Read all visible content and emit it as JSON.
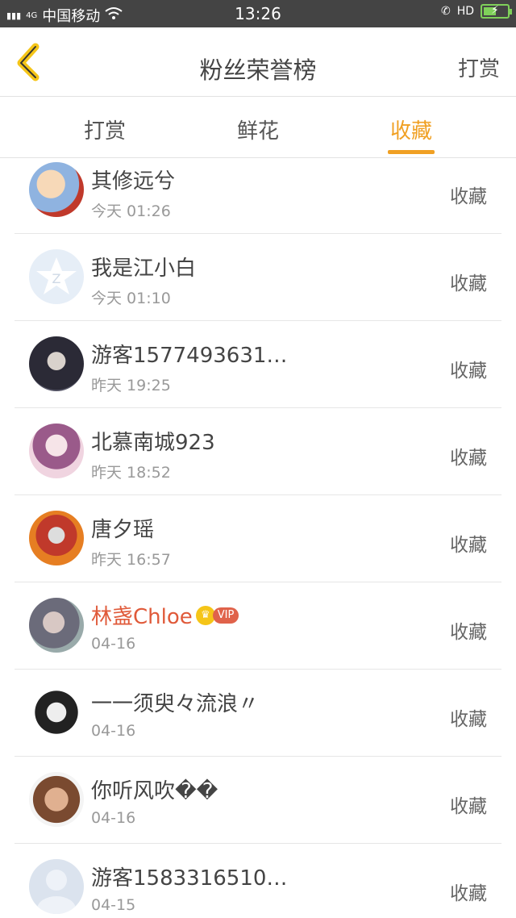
{
  "status_bar": {
    "network_label": "4G",
    "carrier": "中国移动",
    "time": "13:26",
    "hd_label": "HD",
    "battery_level": 0.55
  },
  "navbar": {
    "back_icon": "chevron-left-icon",
    "title": "粉丝荣誉榜",
    "right_label": "打赏"
  },
  "tabs": [
    {
      "label": "打赏",
      "active": false
    },
    {
      "label": "鲜花",
      "active": false
    },
    {
      "label": "收藏",
      "active": true
    }
  ],
  "accent_color": "#f0a023",
  "fans": [
    {
      "name": "其修远兮",
      "time": "今天 01:26",
      "action": "收藏",
      "vip": false
    },
    {
      "name": "我是江小白",
      "time": "今天 01:10",
      "action": "收藏",
      "vip": false
    },
    {
      "name": "游客1577493631…",
      "time": "昨天 19:25",
      "action": "收藏",
      "vip": false
    },
    {
      "name": "北慕南城923",
      "time": "昨天 18:52",
      "action": "收藏",
      "vip": false
    },
    {
      "name": "唐夕瑶",
      "time": "昨天 16:57",
      "action": "收藏",
      "vip": false
    },
    {
      "name": "林盏Chloe",
      "time": "04-16",
      "action": "收藏",
      "vip": true,
      "vip_label": "VIP"
    },
    {
      "name": "一一须臾々流浪〃",
      "time": "04-16",
      "action": "收藏",
      "vip": false
    },
    {
      "name": "你听风吹��",
      "time": "04-16",
      "action": "收藏",
      "vip": false
    },
    {
      "name": "游客1583316510…",
      "time": "04-15",
      "action": "收藏",
      "vip": false
    }
  ]
}
